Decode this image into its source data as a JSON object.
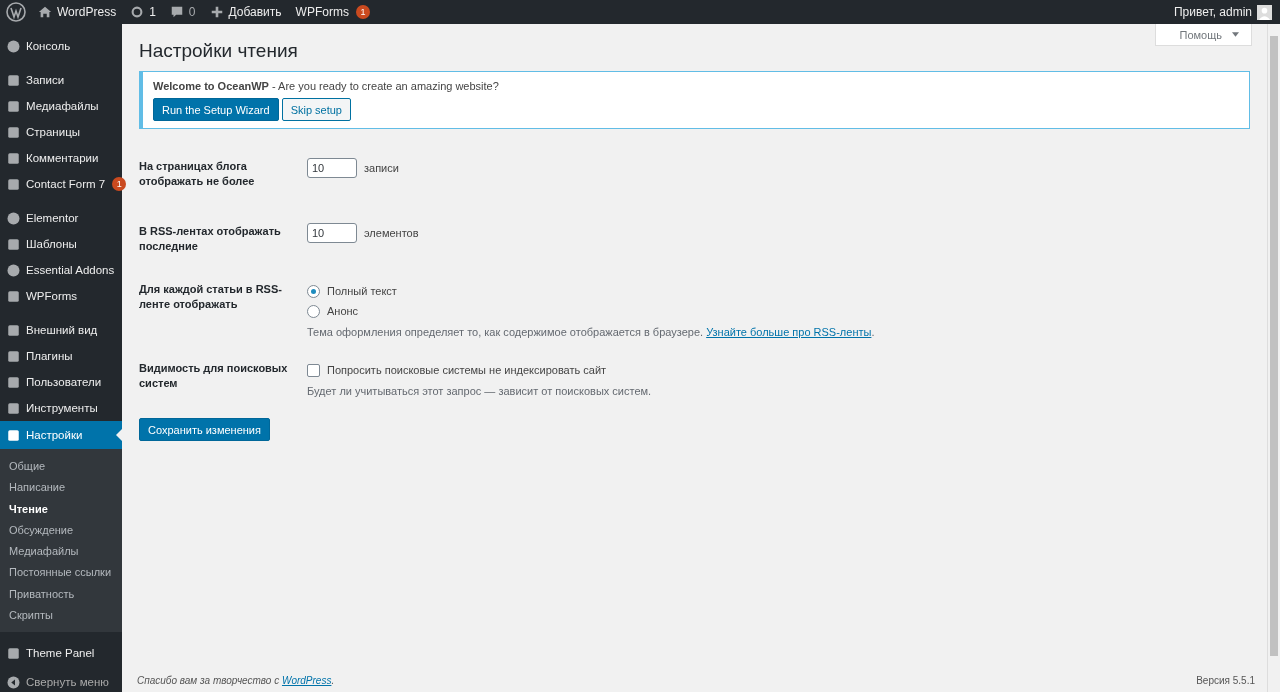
{
  "admin_bar": {
    "site": "WordPress",
    "updates": "1",
    "comments": "0",
    "add_new": "Добавить",
    "wpforms": "WPForms",
    "wpforms_badge": "1",
    "greeting": "Привет, admin"
  },
  "sidebar": {
    "groups": [
      [
        {
          "label": "Консоль",
          "selected": false
        }
      ],
      [
        {
          "label": "Записи",
          "selected": false
        },
        {
          "label": "Медиафайлы",
          "selected": false
        },
        {
          "label": "Страницы",
          "selected": false
        },
        {
          "label": "Комментарии",
          "selected": false
        },
        {
          "label": "Contact Form 7",
          "badge": "1",
          "selected": false
        }
      ],
      [
        {
          "label": "Elementor",
          "selected": false
        },
        {
          "label": "Шаблоны",
          "selected": false
        },
        {
          "label": "Essential Addons",
          "selected": false
        },
        {
          "label": "WPForms",
          "selected": false
        }
      ],
      [
        {
          "label": "Внешний вид",
          "selected": false
        },
        {
          "label": "Плагины",
          "selected": false
        },
        {
          "label": "Пользователи",
          "selected": false
        },
        {
          "label": "Инструменты",
          "selected": false
        },
        {
          "label": "Настройки",
          "selected": true,
          "children": [
            {
              "label": "Общие",
              "selected": false
            },
            {
              "label": "Написание",
              "selected": false
            },
            {
              "label": "Чтение",
              "selected": true
            },
            {
              "label": "Обсуждение",
              "selected": false
            },
            {
              "label": "Медиафайлы",
              "selected": false
            },
            {
              "label": "Постоянные ссылки",
              "selected": false
            },
            {
              "label": "Приватность",
              "selected": false
            },
            {
              "label": "Скрипты",
              "selected": false
            }
          ]
        }
      ],
      [
        {
          "label": "Theme Panel",
          "selected": false
        }
      ]
    ],
    "collapse": "Свернуть меню"
  },
  "help_button": "Помощь",
  "title": "Настройки чтения",
  "notice": {
    "text": "**Welcome to OceanWP** - Are you ready to create an amazing website?",
    "buttons": [
      "Run the Setup Wizard",
      "Skip setup"
    ]
  },
  "settings": [
    {
      "kind": "number",
      "label": "На страницах блога отображать не более",
      "value": "10",
      "suffix": "записи"
    },
    {
      "kind": "number",
      "label": "В RSS-лентах отображать последние",
      "value": "10",
      "suffix": "элементов"
    },
    {
      "kind": "radio",
      "label": "Для каждой статьи в RSS-ленте отображать",
      "options": [
        {
          "label": "Полный текст",
          "selected": true
        },
        {
          "label": "Анонс",
          "selected": false
        }
      ],
      "description": "Тема оформления определяет то, как содержимое отображается в браузере.",
      "link": "Узнайте больше про RSS-ленты",
      "after_link": "."
    },
    {
      "kind": "checkbox",
      "label": "Видимость для поисковых систем",
      "option": "Попросить поисковые системы не индексировать сайт",
      "checked": false,
      "description": "Будет ли учитываться этот запрос — зависит от поисковых систем."
    }
  ],
  "save_button": "Сохранить изменения",
  "footer": {
    "thanks": "Спасибо вам за творчество с",
    "link": "WordPress",
    "after_link": ".",
    "version": "Версия 5.5.1"
  }
}
